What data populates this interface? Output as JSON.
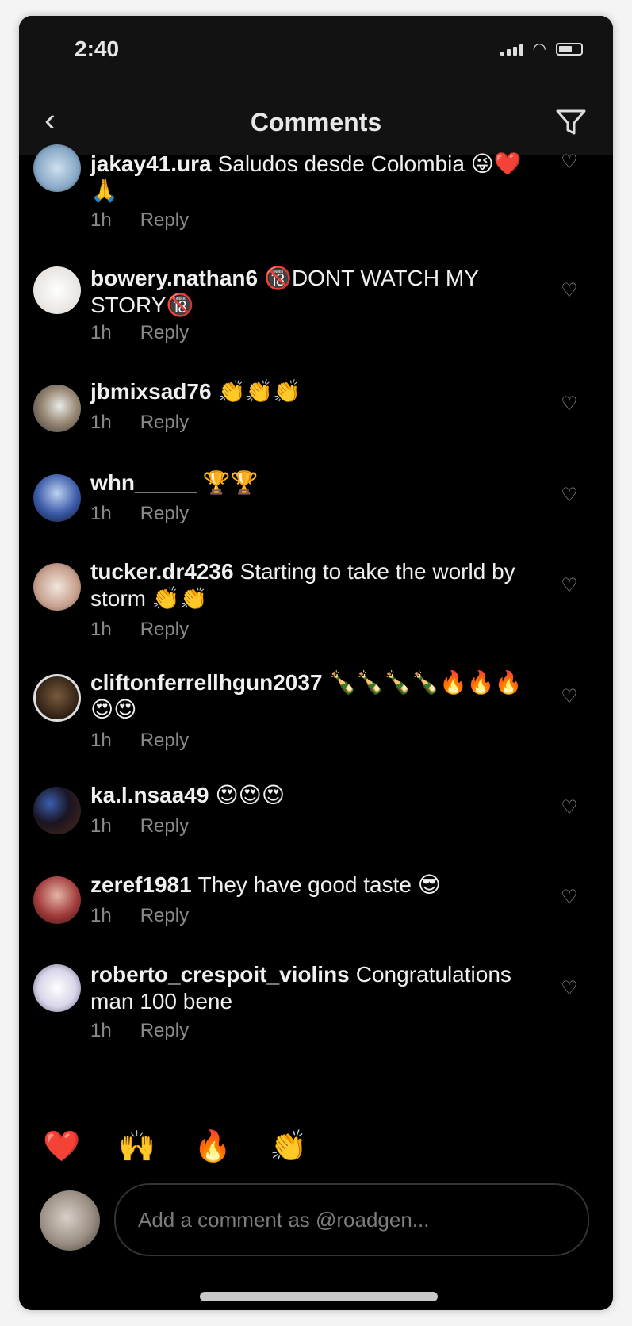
{
  "status": {
    "time": "2:40"
  },
  "header": {
    "title": "Comments"
  },
  "comments": [
    {
      "user": "jakay41.ura",
      "text": "Saludos desde Colombia 😜❤️🙏",
      "time": "1h",
      "reply_label": "Reply"
    },
    {
      "user": "bowery.nathan6",
      "text": "🔞DONT WATCH MY STORY🔞",
      "time": "1h",
      "reply_label": "Reply"
    },
    {
      "user": "jbmixsad76",
      "text": "👏👏👏",
      "time": "1h",
      "reply_label": "Reply"
    },
    {
      "user": "whn_____",
      "text": "🏆🏆",
      "time": "1h",
      "reply_label": "Reply"
    },
    {
      "user": "tucker.dr4236",
      "text": "Starting to take the world by storm 👏👏",
      "time": "1h",
      "reply_label": "Reply"
    },
    {
      "user": "cliftonferrellhgun2037",
      "text": "🍾🍾🍾🍾🔥🔥🔥😍😍",
      "time": "1h",
      "reply_label": "Reply"
    },
    {
      "user": "ka.l.nsaa49",
      "text": "😍😍😍",
      "time": "1h",
      "reply_label": "Reply"
    },
    {
      "user": "zeref1981",
      "text": "They have good taste 😎",
      "time": "1h",
      "reply_label": "Reply"
    },
    {
      "user": "roberto_crespoit_violins",
      "text": "Congratulations man 100 bene",
      "time": "1h",
      "reply_label": "Reply"
    }
  ],
  "reactions": [
    "❤️",
    "🙌",
    "🔥",
    "👏",
    "😢",
    "😍",
    "😮",
    "😂"
  ],
  "composer": {
    "placeholder": "Add a comment as @roadgen..."
  },
  "icons": {
    "back": "back-arrow-icon",
    "filter": "filter-icon",
    "heart": "heart-outline-icon"
  }
}
